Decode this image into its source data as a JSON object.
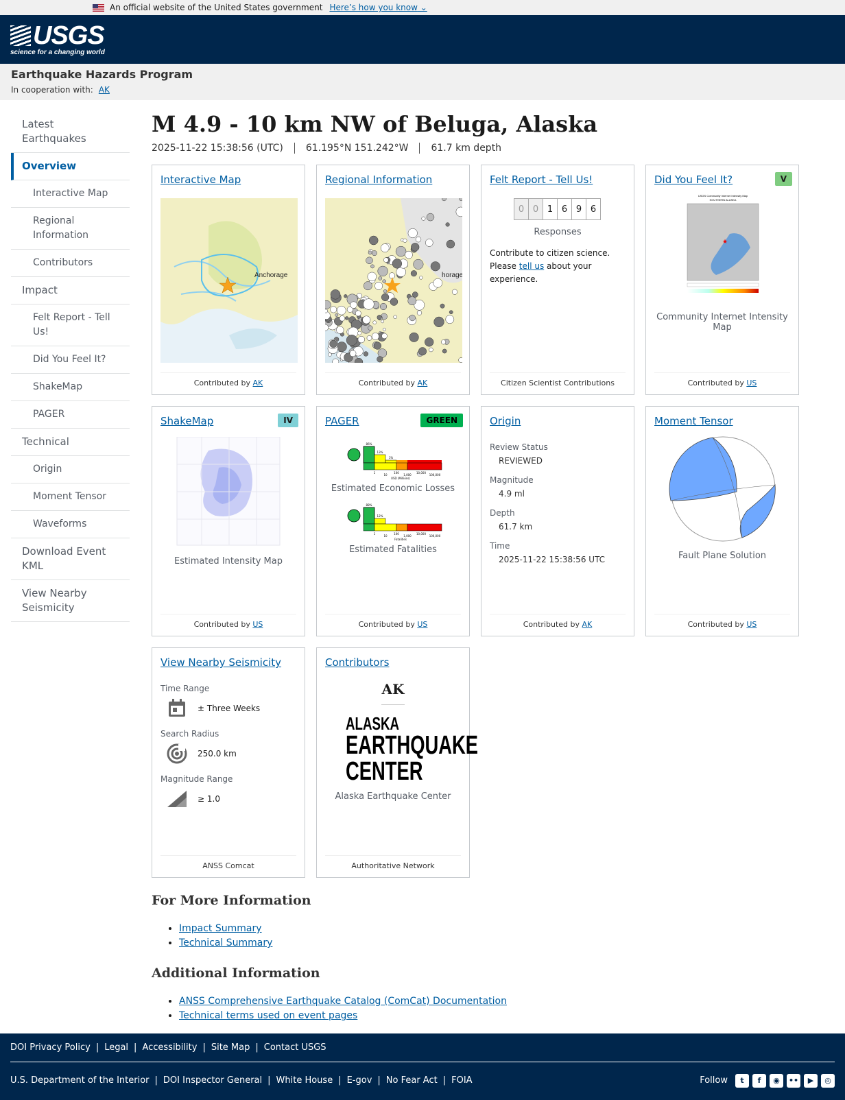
{
  "banner": {
    "text": "An official website of the United States government",
    "link": "Here’s how you know"
  },
  "header": {
    "logo": "USGS",
    "tagline": "science for a changing world"
  },
  "program": {
    "name": "Earthquake Hazards Program",
    "coop_label": "In cooperation with:",
    "coop_link": "AK"
  },
  "sidenav": [
    {
      "label": "Latest Earthquakes",
      "level": 0
    },
    {
      "label": "Overview",
      "level": 0,
      "active": true
    },
    {
      "label": "Interactive Map",
      "level": 1
    },
    {
      "label": "Regional Information",
      "level": 1
    },
    {
      "label": "Contributors",
      "level": 1
    },
    {
      "label": "Impact",
      "level": 0
    },
    {
      "label": "Felt Report - Tell Us!",
      "level": 1
    },
    {
      "label": "Did You Feel It?",
      "level": 1
    },
    {
      "label": "ShakeMap",
      "level": 1
    },
    {
      "label": "PAGER",
      "level": 1
    },
    {
      "label": "Technical",
      "level": 0
    },
    {
      "label": "Origin",
      "level": 1
    },
    {
      "label": "Moment Tensor",
      "level": 1
    },
    {
      "label": "Waveforms",
      "level": 1
    },
    {
      "label": "Download Event KML",
      "level": 0
    },
    {
      "label": "View Nearby Seismicity",
      "level": 0
    }
  ],
  "event": {
    "title": "M 4.9 - 10 km NW of Beluga, Alaska",
    "time": "2025-11-22 15:38:56 (UTC)",
    "coords": "61.195°N 151.242°W",
    "depth": "61.7 km depth"
  },
  "cards": {
    "map": {
      "title": "Interactive Map",
      "label": "Anchorage",
      "contrib_prefix": "Contributed by",
      "contrib": "AK"
    },
    "regional": {
      "title": "Regional Information",
      "label": "horage",
      "contrib_prefix": "Contributed by",
      "contrib": "AK"
    },
    "felt": {
      "title": "Felt Report - Tell Us!",
      "digits": [
        "0",
        "0",
        "1",
        "6",
        "9",
        "6"
      ],
      "responses": "Responses",
      "text_a": "Contribute to citizen science. Please",
      "link": "tell us",
      "text_b": "about your experience.",
      "footer": "Citizen Scientist Contributions"
    },
    "dyfi": {
      "title": "Did You Feel It?",
      "badge": "V",
      "badge_color": "#7fcc80",
      "caption": "Community Internet Intensity Map",
      "contrib_prefix": "Contributed by",
      "contrib": "US",
      "map_title": "USGS Community Internet Intensity Map",
      "map_subtitle": "SOUTHERN ALASKA"
    },
    "shakemap": {
      "title": "ShakeMap",
      "badge": "IV",
      "badge_color": "#7fd0d6",
      "caption": "Estimated Intensity Map",
      "contrib_prefix": "Contributed by",
      "contrib": "US"
    },
    "pager": {
      "title": "PAGER",
      "badge": "GREEN",
      "badge_color": "#00b050",
      "losses": "Estimated Economic Losses",
      "fatalities": "Estimated Fatalities",
      "contrib_prefix": "Contributed by",
      "contrib": "US",
      "losses_pct": [
        "86%",
        "13%",
        "1%"
      ],
      "fatal_pct": [
        "88%",
        "12%"
      ],
      "scale": [
        "1",
        "10",
        "100",
        "1,000",
        "10,000",
        "100,000"
      ],
      "losses_unit": "USD (Millions)",
      "fatal_unit": "Fatalities"
    },
    "origin": {
      "title": "Origin",
      "review_label": "Review Status",
      "review": "REVIEWED",
      "mag_label": "Magnitude",
      "mag": "4.9 ml",
      "depth_label": "Depth",
      "depth": "61.7 km",
      "time_label": "Time",
      "time": "2025-11-22 15:38:56 UTC",
      "contrib_prefix": "Contributed by",
      "contrib": "AK"
    },
    "tensor": {
      "title": "Moment Tensor",
      "caption": "Fault Plane Solution",
      "contrib_prefix": "Contributed by",
      "contrib": "US",
      "fill_color": "#6fa8ff"
    },
    "nearby": {
      "title": "View Nearby Seismicity",
      "time_label": "Time Range",
      "time": "± Three Weeks",
      "radius_label": "Search Radius",
      "radius": "250.0 km",
      "mag_label": "Magnitude Range",
      "mag": "≥ 1.0",
      "footer": "ANSS Comcat"
    },
    "contributors": {
      "title": "Contributors",
      "code": "AK",
      "logo_line1": "ALASKA",
      "logo_line2": "EARTHQUAKE",
      "logo_line3": "CENTER",
      "name": "Alaska Earthquake Center",
      "footer": "Authoritative Network"
    }
  },
  "more_info": {
    "heading": "For More Information",
    "links": [
      "Impact Summary",
      "Technical Summary"
    ]
  },
  "additional": {
    "heading": "Additional Information",
    "links": [
      "ANSS Comprehensive Earthquake Catalog (ComCat) Documentation",
      "Technical terms used on event pages"
    ]
  },
  "footer": {
    "row1": [
      "DOI Privacy Policy",
      "Legal",
      "Accessibility",
      "Site Map",
      "Contact USGS"
    ],
    "row2": [
      "U.S. Department of the Interior",
      "DOI Inspector General",
      "White House",
      "E-gov",
      "No Fear Act",
      "FOIA"
    ],
    "follow": "Follow",
    "social": [
      "twitter-icon",
      "facebook-icon",
      "github-icon",
      "flickr-icon",
      "youtube-icon",
      "instagram-icon"
    ]
  }
}
